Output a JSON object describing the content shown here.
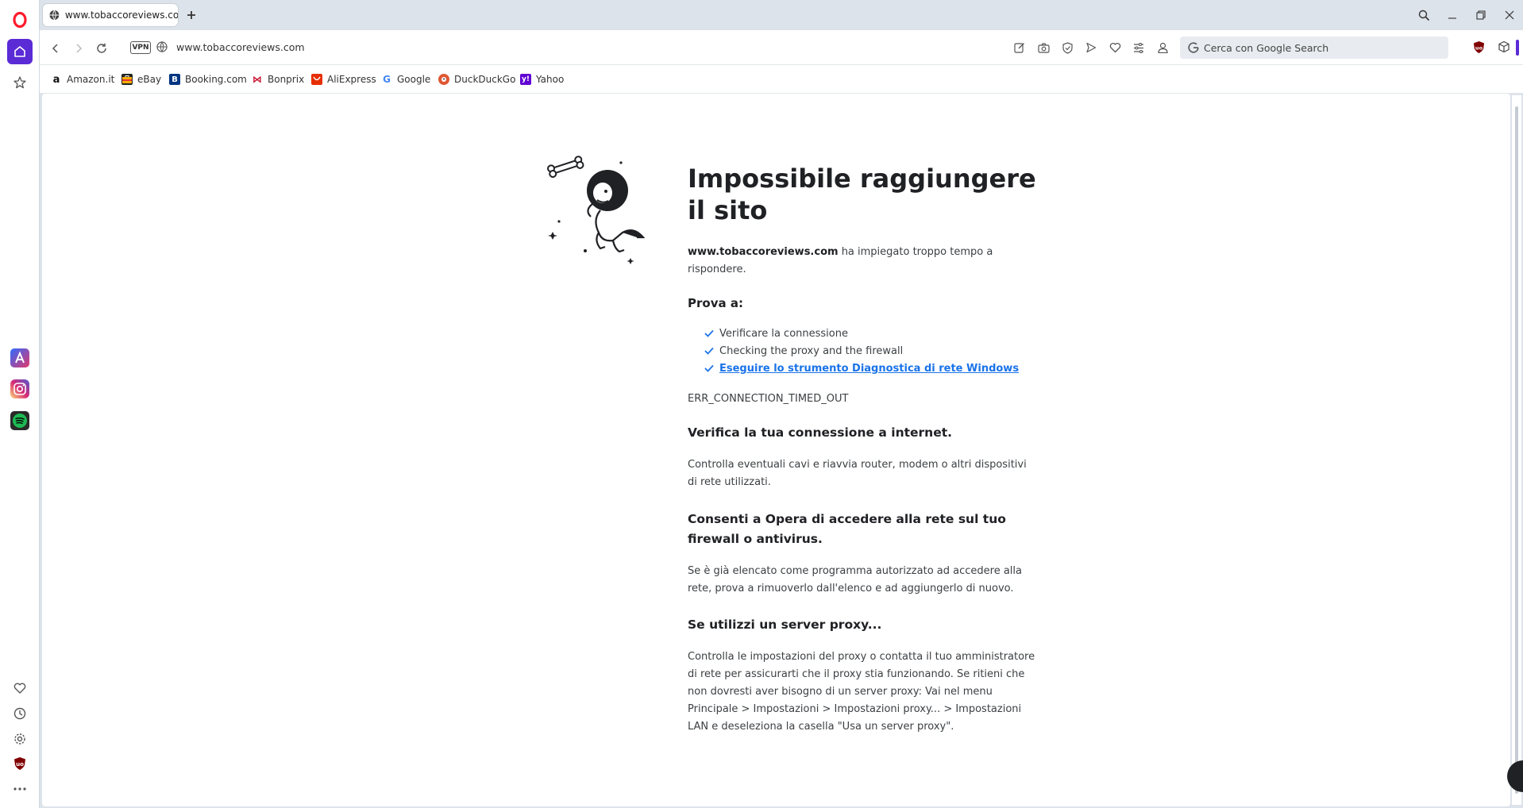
{
  "browser": {
    "tab": {
      "title": "www.tobaccoreviews.com"
    },
    "address": {
      "url": "www.tobaccoreviews.com",
      "vpn_label": "VPN"
    },
    "search": {
      "placeholder": "Cerca con Google Search"
    },
    "bookmarks": [
      {
        "label": "Amazon.it",
        "icon": "amazon-icon",
        "color": "#ffffff"
      },
      {
        "label": "eBay",
        "icon": "ebay-icon",
        "color": "#f5af02"
      },
      {
        "label": "Booking.com",
        "icon": "booking-icon",
        "color": "#003580"
      },
      {
        "label": "Bonprix",
        "icon": "bonprix-icon",
        "color": "#c8102e"
      },
      {
        "label": "AliExpress",
        "icon": "aliexpress-icon",
        "color": "#e62e04"
      },
      {
        "label": "Google",
        "icon": "google-icon",
        "color": "#ffffff"
      },
      {
        "label": "DuckDuckGo",
        "icon": "duckduckgo-icon",
        "color": "#de5833"
      },
      {
        "label": "Yahoo",
        "icon": "yahoo-icon",
        "color": "#6001d2"
      }
    ]
  },
  "sidebar": {
    "items": [
      {
        "name": "opera-logo",
        "color": "#ff1b2d"
      },
      {
        "name": "home-icon",
        "color": "#5b2bd6"
      },
      {
        "name": "star-icon"
      },
      {
        "name": "aria-app-icon"
      },
      {
        "name": "instagram-icon"
      },
      {
        "name": "spotify-icon",
        "color": "#1db954"
      },
      {
        "name": "heart-icon"
      },
      {
        "name": "history-icon"
      },
      {
        "name": "settings-icon"
      },
      {
        "name": "ublock-icon"
      },
      {
        "name": "more-icon"
      }
    ]
  },
  "error_page": {
    "title": "Impossibile raggiungere il sito",
    "host": "www.tobaccoreviews.com",
    "host_suffix": " ha impiegato troppo tempo a rispondere.",
    "try_heading": "Prova a:",
    "suggestions": [
      "Verificare la connessione",
      "Checking the proxy and the firewall"
    ],
    "diagnostics_link": "Eseguire lo strumento Diagnostica di rete Windows",
    "error_code": "ERR_CONNECTION_TIMED_OUT",
    "sections": [
      {
        "heading": "Verifica la tua connessione a internet.",
        "body": "Controlla eventuali cavi e riavvia router, modem o altri dispositivi di rete utilizzati."
      },
      {
        "heading": "Consenti a Opera di accedere alla rete sul tuo firewall o antivirus.",
        "body": "Se è già elencato come programma autorizzato ad accedere alla rete, prova a rimuoverlo dall'elenco e ad aggiungerlo di nuovo."
      },
      {
        "heading": "Se utilizzi un server proxy...",
        "body": "Controlla le impostazioni del proxy o contatta il tuo amministratore di rete per assicurarti che il proxy stia funzionando. Se ritieni che non dovresti aver bisogno di un server proxy: Vai nel menu Principale > Impostazioni > Impostazioni proxy... > Impostazioni LAN e deseleziona la casella \"Usa un server proxy\"."
      }
    ]
  }
}
